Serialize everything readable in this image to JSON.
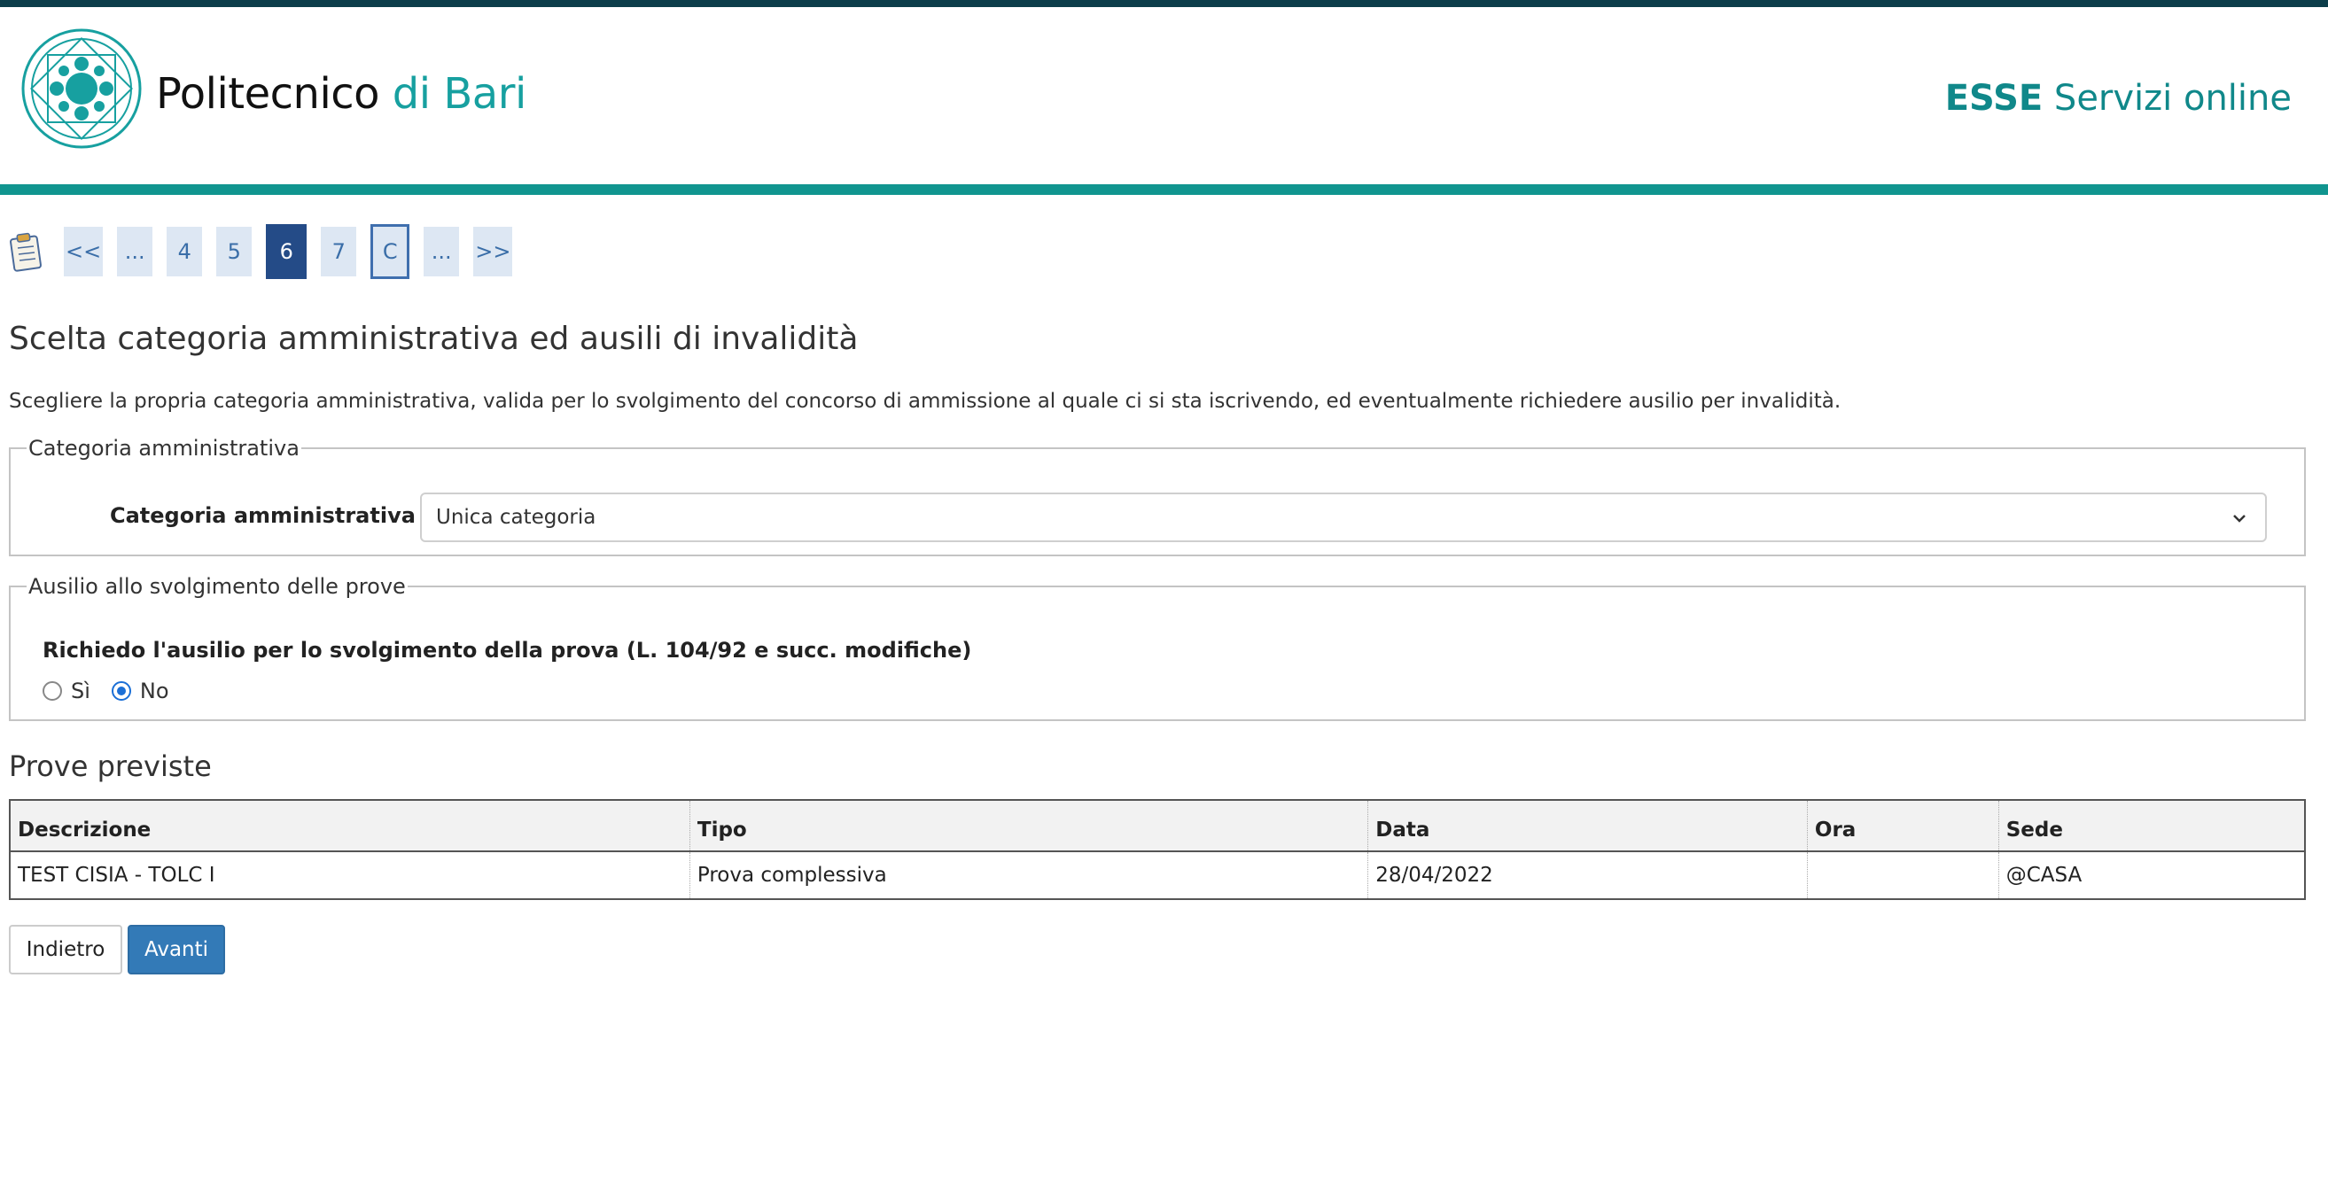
{
  "header": {
    "brand_main": "Politecnico",
    "brand_accent": "di Bari",
    "service_bold": "ESSE",
    "service_rest": "Servizi online",
    "colors": {
      "topbar": "#0c3d4a",
      "accent": "#17a0a0",
      "rule": "#10958f"
    }
  },
  "stepper": {
    "icon": "clipboard-icon",
    "items": [
      {
        "label": "<<",
        "state": "normal"
      },
      {
        "label": "...",
        "state": "normal"
      },
      {
        "label": "4",
        "state": "normal"
      },
      {
        "label": "5",
        "state": "normal"
      },
      {
        "label": "6",
        "state": "active"
      },
      {
        "label": "7",
        "state": "normal"
      },
      {
        "label": "C",
        "state": "outlined"
      },
      {
        "label": "...",
        "state": "normal"
      },
      {
        "label": ">>",
        "state": "normal"
      }
    ]
  },
  "page": {
    "title": "Scelta categoria amministrativa ed ausili di invalidità",
    "intro": "Scegliere la propria categoria amministrativa, valida per lo svolgimento del concorso di ammissione al quale ci si sta iscrivendo, ed eventualmente richiedere ausilio per invalidità."
  },
  "categoria": {
    "legend": "Categoria amministrativa",
    "label": "Categoria amministrativa",
    "selected": "Unica categoria"
  },
  "ausilio": {
    "legend": "Ausilio allo svolgimento delle prove",
    "question": "Richiedo l'ausilio per lo svolgimento della prova (L. 104/92 e succ. modifiche)",
    "option_yes": "Sì",
    "option_no": "No",
    "selected": "No"
  },
  "prove": {
    "title": "Prove previste",
    "columns": [
      "Descrizione",
      "Tipo",
      "Data",
      "Ora",
      "Sede"
    ],
    "rows": [
      [
        "TEST CISIA - TOLC I",
        "Prova complessiva",
        "28/04/2022",
        "",
        "@CASA"
      ]
    ]
  },
  "buttons": {
    "back": "Indietro",
    "next": "Avanti"
  }
}
